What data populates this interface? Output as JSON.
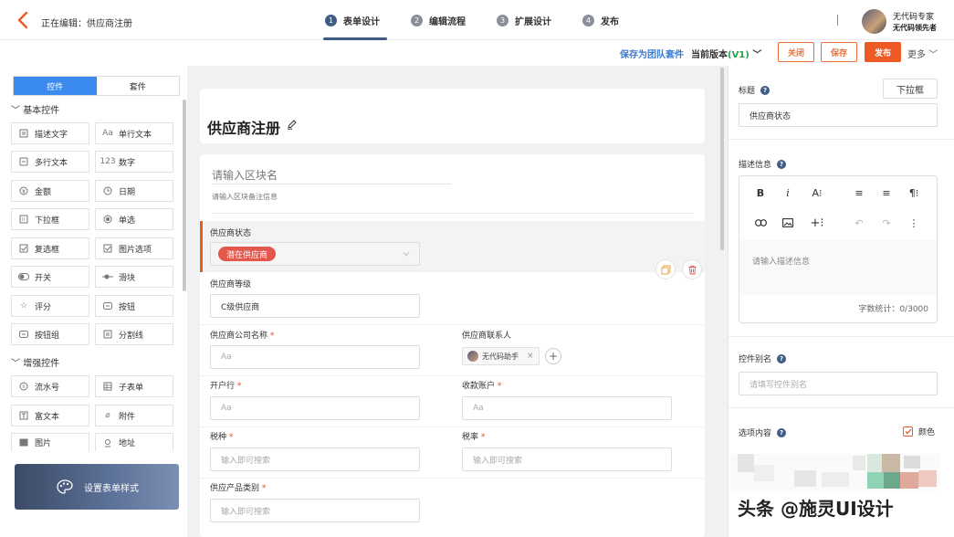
{
  "header": {
    "editing_label": "正在编辑：供应商注册",
    "steps": [
      {
        "num": "1",
        "label": "表单设计",
        "active": true
      },
      {
        "num": "2",
        "label": "编辑流程",
        "active": false
      },
      {
        "num": "3",
        "label": "扩展设计",
        "active": false
      },
      {
        "num": "4",
        "label": "发布",
        "active": false
      }
    ],
    "separator": "|",
    "user_name": "无代码专家",
    "user_subtitle": "无代码领先者"
  },
  "toolbar": {
    "save_as_suite": "保存为团队套件",
    "version_prefix": "当前版本",
    "version_value": "(V1)",
    "close": "关闭",
    "save": "保存",
    "publish": "发布",
    "more": "更多"
  },
  "left_panel": {
    "tabs": [
      {
        "label": "控件",
        "active": true
      },
      {
        "label": "套件",
        "active": false
      }
    ],
    "basic_group": "基本控件",
    "basic_controls": [
      {
        "label": "描述文字",
        "icon": "doc-icon"
      },
      {
        "label": "单行文本",
        "icon": "text-icon"
      },
      {
        "label": "多行文本",
        "icon": "multiline-icon"
      },
      {
        "label": "数字",
        "icon": "number-icon"
      },
      {
        "label": "金额",
        "icon": "money-icon"
      },
      {
        "label": "日期",
        "icon": "clock-icon"
      },
      {
        "label": "下拉框",
        "icon": "dropdown-icon"
      },
      {
        "label": "单选",
        "icon": "radio-icon"
      },
      {
        "label": "复选框",
        "icon": "checkbox-icon"
      },
      {
        "label": "图片选项",
        "icon": "image-option-icon"
      },
      {
        "label": "开关",
        "icon": "toggle-icon"
      },
      {
        "label": "滑块",
        "icon": "slider-icon"
      },
      {
        "label": "评分",
        "icon": "star-icon"
      },
      {
        "label": "按钮",
        "icon": "button-icon"
      },
      {
        "label": "按钮组",
        "icon": "button-group-icon"
      },
      {
        "label": "分割线",
        "icon": "divider-icon"
      }
    ],
    "enhanced_group": "增强控件",
    "enhanced_controls": [
      {
        "label": "流水号",
        "icon": "serial-icon"
      },
      {
        "label": "子表单",
        "icon": "subform-icon"
      },
      {
        "label": "富文本",
        "icon": "richtext-icon"
      },
      {
        "label": "附件",
        "icon": "paperclip-icon"
      },
      {
        "label": "图片",
        "icon": "picture-icon"
      },
      {
        "label": "地址",
        "icon": "location-icon"
      }
    ],
    "style_banner": "设置表单样式"
  },
  "canvas": {
    "form_title": "供应商注册",
    "block_name_placeholder": "请输入区块名",
    "block_note_placeholder": "请输入区块备注信息",
    "fields": {
      "supplier_status": {
        "label": "供应商状态",
        "value": "潜在供应商"
      },
      "supplier_level": {
        "label": "供应商等级",
        "value": "C级供应商"
      },
      "company_name": {
        "label": "供应商公司名称",
        "required": "*",
        "placeholder": "Aa"
      },
      "contact": {
        "label": "供应商联系人",
        "user": "无代码助手",
        "remove": "×",
        "add": "+"
      },
      "bank": {
        "label": "开户行",
        "required": "*",
        "placeholder": "Aa"
      },
      "account": {
        "label": "收款账户",
        "required": "*",
        "placeholder": "Aa"
      },
      "tax_type": {
        "label": "税种",
        "required": "*",
        "placeholder": "输入即可搜索"
      },
      "tax_rate": {
        "label": "税率",
        "required": "*",
        "placeholder": "输入即可搜索"
      },
      "product_category": {
        "label": "供应产品类别",
        "required": "*",
        "placeholder": "输入即可搜索"
      }
    }
  },
  "right_panel": {
    "title_label": "标题",
    "help": "?",
    "type_button": "下拉框",
    "title_value": "供应商状态",
    "desc_label": "描述信息",
    "desc_placeholder": "请输入描述信息",
    "char_count": "字数统计：0/3000",
    "alias_label": "控件别名",
    "alias_placeholder": "请填写控件别名",
    "options_label": "选项内容",
    "color_label": "颜色"
  },
  "watermark": "头条 @施灵UI设计",
  "colors": {
    "accent": "#ee5a24",
    "active_step": "#3f5b86",
    "tab_blue": "#3b8af0",
    "chip_red": "#e4574c",
    "link_blue": "#3a7bd5",
    "version_green": "#2e9f4a"
  }
}
